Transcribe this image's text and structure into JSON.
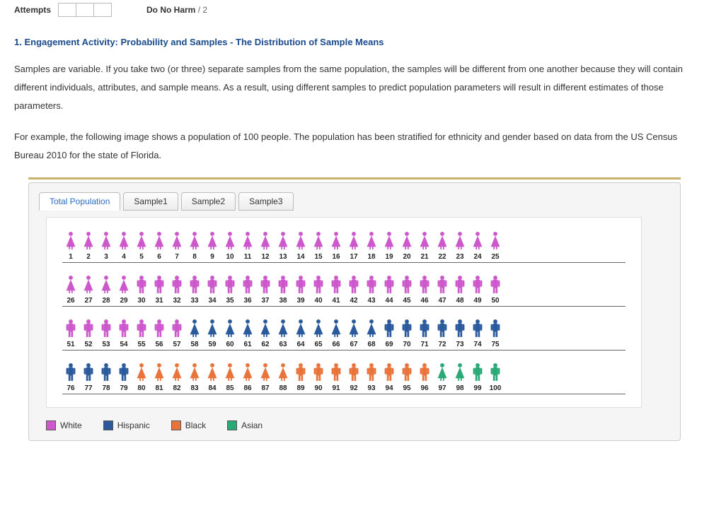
{
  "header": {
    "attempts_label": "Attempts",
    "do_no_harm_label": "Do No Harm",
    "do_no_harm_total": "2"
  },
  "question": {
    "title": "1. Engagement Activity: Probability and Samples - The Distribution of Sample Means",
    "para1": "Samples are variable. If you take two (or three) separate samples from the same population, the samples will be different from one another because they will contain different individuals, attributes, and sample means. As a result, using different samples to predict population parameters will result in different estimates of those parameters.",
    "para2": "For example, the following image shows a population of 100 people. The population has been stratified for ethnicity and gender based on data from the US Census Bureau 2010 for the state of Florida."
  },
  "tabs": [
    "Total Population",
    "Sample1",
    "Sample2",
    "Sample3"
  ],
  "active_tab": 0,
  "colors": {
    "White": "#cc58cc",
    "Hispanic": "#2a5a9c",
    "Black": "#e8743b",
    "Asian": "#2aa876"
  },
  "legend": [
    "White",
    "Hispanic",
    "Black",
    "Asian"
  ],
  "population": [
    {
      "n": 1,
      "e": "White",
      "g": "F"
    },
    {
      "n": 2,
      "e": "White",
      "g": "F"
    },
    {
      "n": 3,
      "e": "White",
      "g": "F"
    },
    {
      "n": 4,
      "e": "White",
      "g": "F"
    },
    {
      "n": 5,
      "e": "White",
      "g": "F"
    },
    {
      "n": 6,
      "e": "White",
      "g": "F"
    },
    {
      "n": 7,
      "e": "White",
      "g": "F"
    },
    {
      "n": 8,
      "e": "White",
      "g": "F"
    },
    {
      "n": 9,
      "e": "White",
      "g": "F"
    },
    {
      "n": 10,
      "e": "White",
      "g": "F"
    },
    {
      "n": 11,
      "e": "White",
      "g": "F"
    },
    {
      "n": 12,
      "e": "White",
      "g": "F"
    },
    {
      "n": 13,
      "e": "White",
      "g": "F"
    },
    {
      "n": 14,
      "e": "White",
      "g": "F"
    },
    {
      "n": 15,
      "e": "White",
      "g": "F"
    },
    {
      "n": 16,
      "e": "White",
      "g": "F"
    },
    {
      "n": 17,
      "e": "White",
      "g": "F"
    },
    {
      "n": 18,
      "e": "White",
      "g": "F"
    },
    {
      "n": 19,
      "e": "White",
      "g": "F"
    },
    {
      "n": 20,
      "e": "White",
      "g": "F"
    },
    {
      "n": 21,
      "e": "White",
      "g": "F"
    },
    {
      "n": 22,
      "e": "White",
      "g": "F"
    },
    {
      "n": 23,
      "e": "White",
      "g": "F"
    },
    {
      "n": 24,
      "e": "White",
      "g": "F"
    },
    {
      "n": 25,
      "e": "White",
      "g": "F"
    },
    {
      "n": 26,
      "e": "White",
      "g": "F"
    },
    {
      "n": 27,
      "e": "White",
      "g": "F"
    },
    {
      "n": 28,
      "e": "White",
      "g": "F"
    },
    {
      "n": 29,
      "e": "White",
      "g": "F"
    },
    {
      "n": 30,
      "e": "White",
      "g": "M"
    },
    {
      "n": 31,
      "e": "White",
      "g": "M"
    },
    {
      "n": 32,
      "e": "White",
      "g": "M"
    },
    {
      "n": 33,
      "e": "White",
      "g": "M"
    },
    {
      "n": 34,
      "e": "White",
      "g": "M"
    },
    {
      "n": 35,
      "e": "White",
      "g": "M"
    },
    {
      "n": 36,
      "e": "White",
      "g": "M"
    },
    {
      "n": 37,
      "e": "White",
      "g": "M"
    },
    {
      "n": 38,
      "e": "White",
      "g": "M"
    },
    {
      "n": 39,
      "e": "White",
      "g": "M"
    },
    {
      "n": 40,
      "e": "White",
      "g": "M"
    },
    {
      "n": 41,
      "e": "White",
      "g": "M"
    },
    {
      "n": 42,
      "e": "White",
      "g": "M"
    },
    {
      "n": 43,
      "e": "White",
      "g": "M"
    },
    {
      "n": 44,
      "e": "White",
      "g": "M"
    },
    {
      "n": 45,
      "e": "White",
      "g": "M"
    },
    {
      "n": 46,
      "e": "White",
      "g": "M"
    },
    {
      "n": 47,
      "e": "White",
      "g": "M"
    },
    {
      "n": 48,
      "e": "White",
      "g": "M"
    },
    {
      "n": 49,
      "e": "White",
      "g": "M"
    },
    {
      "n": 50,
      "e": "White",
      "g": "M"
    },
    {
      "n": 51,
      "e": "White",
      "g": "M"
    },
    {
      "n": 52,
      "e": "White",
      "g": "M"
    },
    {
      "n": 53,
      "e": "White",
      "g": "M"
    },
    {
      "n": 54,
      "e": "White",
      "g": "M"
    },
    {
      "n": 55,
      "e": "White",
      "g": "M"
    },
    {
      "n": 56,
      "e": "White",
      "g": "M"
    },
    {
      "n": 57,
      "e": "White",
      "g": "M"
    },
    {
      "n": 58,
      "e": "Hispanic",
      "g": "F"
    },
    {
      "n": 59,
      "e": "Hispanic",
      "g": "F"
    },
    {
      "n": 60,
      "e": "Hispanic",
      "g": "F"
    },
    {
      "n": 61,
      "e": "Hispanic",
      "g": "F"
    },
    {
      "n": 62,
      "e": "Hispanic",
      "g": "F"
    },
    {
      "n": 63,
      "e": "Hispanic",
      "g": "F"
    },
    {
      "n": 64,
      "e": "Hispanic",
      "g": "F"
    },
    {
      "n": 65,
      "e": "Hispanic",
      "g": "F"
    },
    {
      "n": 66,
      "e": "Hispanic",
      "g": "F"
    },
    {
      "n": 67,
      "e": "Hispanic",
      "g": "F"
    },
    {
      "n": 68,
      "e": "Hispanic",
      "g": "F"
    },
    {
      "n": 69,
      "e": "Hispanic",
      "g": "M"
    },
    {
      "n": 70,
      "e": "Hispanic",
      "g": "M"
    },
    {
      "n": 71,
      "e": "Hispanic",
      "g": "M"
    },
    {
      "n": 72,
      "e": "Hispanic",
      "g": "M"
    },
    {
      "n": 73,
      "e": "Hispanic",
      "g": "M"
    },
    {
      "n": 74,
      "e": "Hispanic",
      "g": "M"
    },
    {
      "n": 75,
      "e": "Hispanic",
      "g": "M"
    },
    {
      "n": 76,
      "e": "Hispanic",
      "g": "M"
    },
    {
      "n": 77,
      "e": "Hispanic",
      "g": "M"
    },
    {
      "n": 78,
      "e": "Hispanic",
      "g": "M"
    },
    {
      "n": 79,
      "e": "Hispanic",
      "g": "M"
    },
    {
      "n": 80,
      "e": "Black",
      "g": "F"
    },
    {
      "n": 81,
      "e": "Black",
      "g": "F"
    },
    {
      "n": 82,
      "e": "Black",
      "g": "F"
    },
    {
      "n": 83,
      "e": "Black",
      "g": "F"
    },
    {
      "n": 84,
      "e": "Black",
      "g": "F"
    },
    {
      "n": 85,
      "e": "Black",
      "g": "F"
    },
    {
      "n": 86,
      "e": "Black",
      "g": "F"
    },
    {
      "n": 87,
      "e": "Black",
      "g": "F"
    },
    {
      "n": 88,
      "e": "Black",
      "g": "F"
    },
    {
      "n": 89,
      "e": "Black",
      "g": "M"
    },
    {
      "n": 90,
      "e": "Black",
      "g": "M"
    },
    {
      "n": 91,
      "e": "Black",
      "g": "M"
    },
    {
      "n": 92,
      "e": "Black",
      "g": "M"
    },
    {
      "n": 93,
      "e": "Black",
      "g": "M"
    },
    {
      "n": 94,
      "e": "Black",
      "g": "M"
    },
    {
      "n": 95,
      "e": "Black",
      "g": "M"
    },
    {
      "n": 96,
      "e": "Black",
      "g": "M"
    },
    {
      "n": 97,
      "e": "Asian",
      "g": "F"
    },
    {
      "n": 98,
      "e": "Asian",
      "g": "F"
    },
    {
      "n": 99,
      "e": "Asian",
      "g": "M"
    },
    {
      "n": 100,
      "e": "Asian",
      "g": "M"
    }
  ]
}
